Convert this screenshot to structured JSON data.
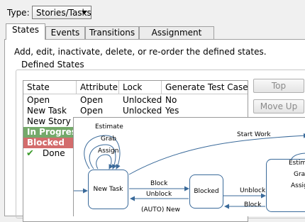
{
  "type_row": {
    "label": "Type:",
    "selected": "Stories/Tasks"
  },
  "tabs": [
    {
      "label": "States",
      "active": true
    },
    {
      "label": "Events"
    },
    {
      "label": "Transitions"
    },
    {
      "label": "Assignment Rules"
    }
  ],
  "instructions": "Add, edit, inactivate, delete, or re-order the defined states.",
  "group_title": "Defined States",
  "table": {
    "columns": [
      "State",
      "Attribute",
      "Lock",
      "Generate Test Case"
    ],
    "rows": [
      {
        "state": "Open",
        "attribute": "Open",
        "lock": "Unlocked",
        "test": "No"
      },
      {
        "state": "New Task",
        "attribute": "Open",
        "lock": "Unlocked",
        "test": "Yes"
      },
      {
        "state": "New Story",
        "attribute": "",
        "lock": "",
        "test": ""
      },
      {
        "state": "In Progress",
        "attribute": "",
        "lock": "",
        "test": "",
        "highlight": "#74a96a"
      },
      {
        "state": "Blocked",
        "attribute": "",
        "lock": "",
        "test": "",
        "highlight": "#d36c6c"
      },
      {
        "state": "Done",
        "attribute": "",
        "lock": "",
        "test": "",
        "icon": "check-icon"
      }
    ]
  },
  "buttons": {
    "top": "Top",
    "move_up": "Move Up"
  },
  "diagram": {
    "nodes": {
      "new_task": "New Task",
      "blocked": "Blocked"
    },
    "edges": {
      "estimate": "Estimate",
      "grab": "Grab",
      "assign": "Assign",
      "start_work": "Start Work",
      "block": "Block",
      "unblock": "Unblock",
      "unblock2": "Unblock",
      "block2": "Block",
      "auto_new": "(AUTO) New",
      "estima_partial": "Estima",
      "grab_partial": "Grab",
      "assign_partial": "Assig"
    }
  },
  "colors": {
    "in_progress": "#74a96a",
    "blocked": "#d36c6c",
    "node_border": "#3a6a9a"
  }
}
